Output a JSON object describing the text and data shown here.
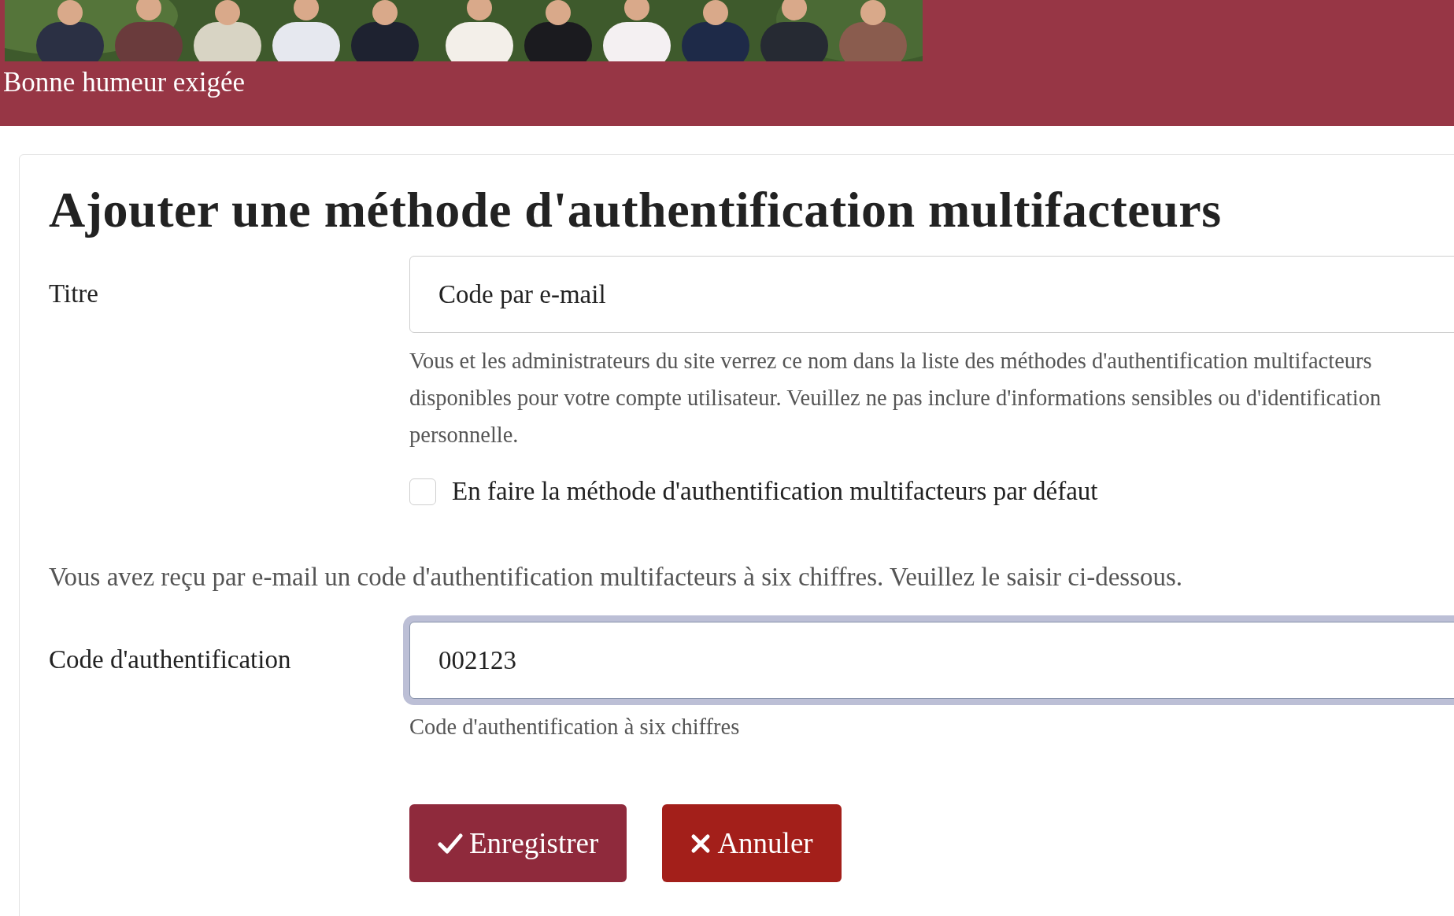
{
  "header": {
    "caption": "Bonne humeur exigée"
  },
  "form": {
    "title": "Ajouter une méthode d'authentification multifacteurs",
    "title_field": {
      "label": "Titre",
      "value": "Code par e-mail",
      "focused": false,
      "help": "Vous et les administrateurs du site verrez ce nom dans la liste des méthodes d'authentification multifacteurs disponibles pour votre compte utilisateur. Veuillez ne pas inclure d'informations sensibles ou d'identification personnelle."
    },
    "default_checkbox": {
      "label": "En faire la méthode d'authentification multifacteurs par défaut",
      "checked": false
    },
    "instruction": "Vous avez reçu par e-mail un code d'authentification multifacteurs à six chiffres. Veuillez le saisir ci-dessous.",
    "code_field": {
      "label": "Code d'authentification",
      "value": "002123",
      "focused": true,
      "help": "Code d'authentification à six chiffres"
    },
    "buttons": [
      {
        "label": "Enregistrer",
        "kind": "save"
      },
      {
        "label": "Annuler",
        "kind": "cancel"
      }
    ]
  }
}
